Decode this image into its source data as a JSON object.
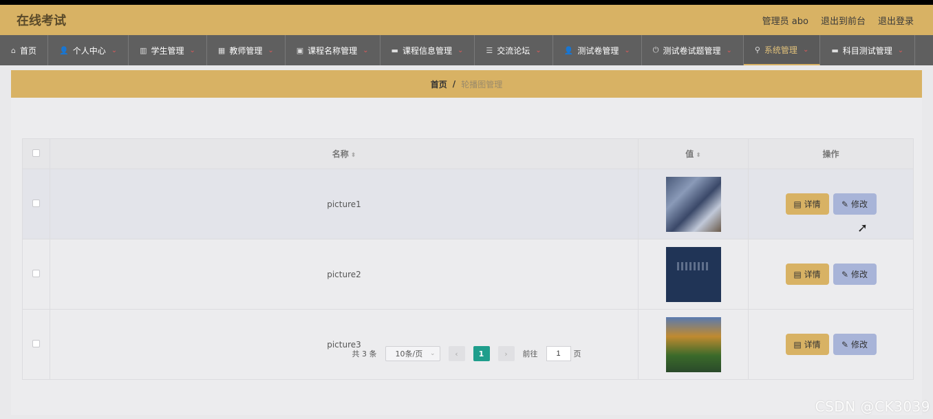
{
  "header": {
    "title": "在线考试",
    "user": "管理员 abo",
    "to_front": "退出到前台",
    "logout": "退出登录"
  },
  "nav": [
    {
      "label": "首页",
      "icon": "home-icon",
      "glyph": "⌂",
      "chevron": false,
      "active": false
    },
    {
      "label": "个人中心",
      "icon": "user-icon",
      "glyph": "👤",
      "chevron": true,
      "active": false
    },
    {
      "label": "学生管理",
      "icon": "bar-chart-icon",
      "glyph": "▥",
      "chevron": true,
      "active": false
    },
    {
      "label": "教师管理",
      "icon": "grid-icon",
      "glyph": "▦",
      "chevron": true,
      "active": false
    },
    {
      "label": "课程名称管理",
      "icon": "clipboard-icon",
      "glyph": "▣",
      "chevron": true,
      "active": false
    },
    {
      "label": "课程信息管理",
      "icon": "monitor-icon",
      "glyph": "▬",
      "chevron": true,
      "active": false
    },
    {
      "label": "交流论坛",
      "icon": "list-icon",
      "glyph": "☰",
      "chevron": true,
      "active": false
    },
    {
      "label": "测试卷管理",
      "icon": "person-icon",
      "glyph": "👤",
      "chevron": true,
      "active": false
    },
    {
      "label": "测试卷试题管理",
      "icon": "power-icon",
      "glyph": "⏻",
      "chevron": true,
      "active": false
    },
    {
      "label": "系统管理",
      "icon": "bell-icon",
      "glyph": "⚲",
      "chevron": true,
      "active": true
    },
    {
      "label": "科目测试管理",
      "icon": "monitor-icon",
      "glyph": "▬",
      "chevron": true,
      "active": false
    }
  ],
  "breadcrumb": {
    "home": "首页",
    "separator": "/",
    "current": "轮播图管理"
  },
  "table": {
    "columns": [
      "名称",
      "值",
      "操作"
    ],
    "rows": [
      {
        "name": "picture1",
        "thumb": "thumb1"
      },
      {
        "name": "picture2",
        "thumb": "thumb2"
      },
      {
        "name": "picture3",
        "thumb": "thumb3"
      }
    ],
    "detail_label": "详情",
    "edit_label": "修改"
  },
  "pager": {
    "total": "共 3 条",
    "page_size": "10条/页",
    "current_page": "1",
    "goto_prefix": "前往",
    "goto_value": "1",
    "goto_suffix": "页"
  },
  "watermark": "CSDN @CK3039",
  "colors": {
    "accent": "#d8b264",
    "nav_bg": "#5f5f5f",
    "edit_btn": "#a8b4d8",
    "pager_active": "#1f9e8c"
  }
}
